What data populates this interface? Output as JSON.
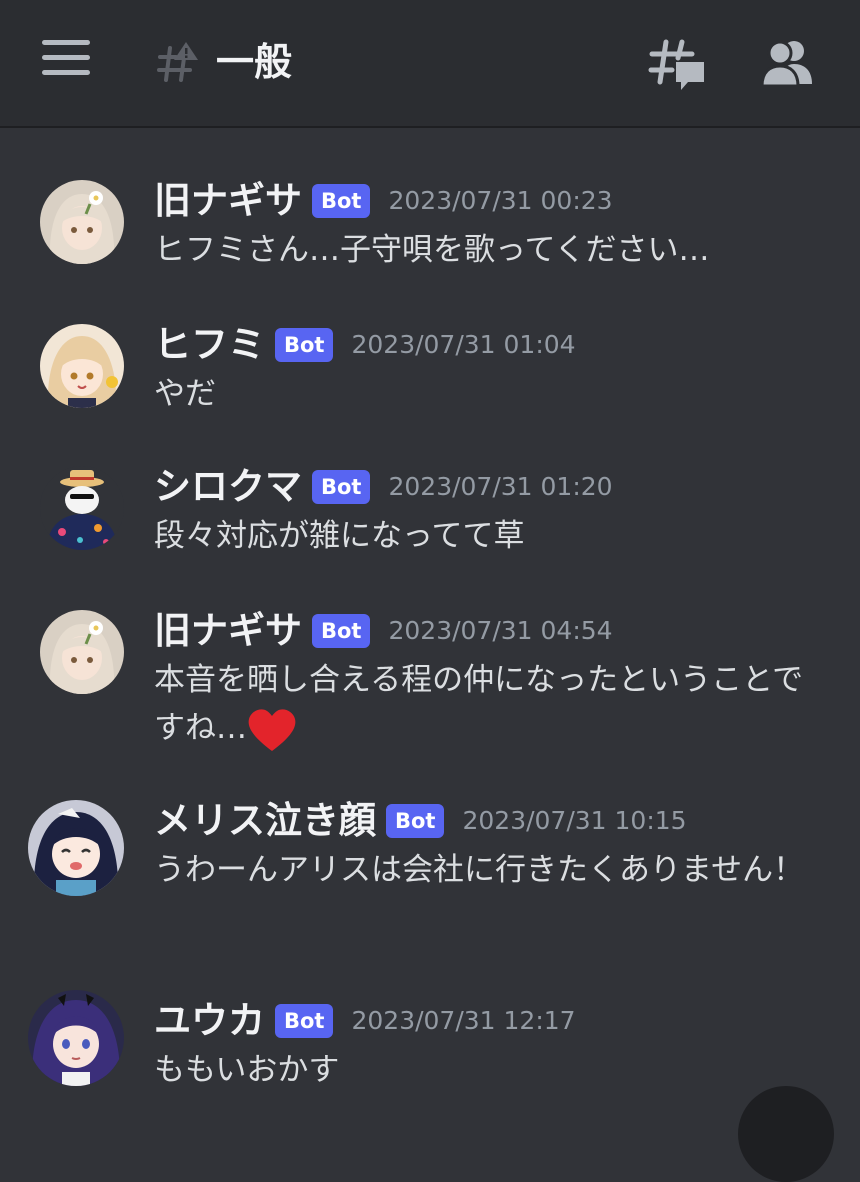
{
  "header": {
    "channel_name": "一般",
    "icons": {
      "menu": "hamburger-menu-icon",
      "channel": "locked-channel-hash-icon",
      "threads": "threads-icon",
      "members": "members-icon"
    }
  },
  "colors": {
    "background": "#313338",
    "header_background": "#2b2d31",
    "bot_badge": "#5865f2",
    "timestamp": "#949ba4",
    "heart": "#e3242b"
  },
  "messages": [
    {
      "author": "旧ナギサ",
      "badge": "Bot",
      "timestamp": "2023/07/31 00:23",
      "text": "ヒフミさん…子守唄を歌ってください…"
    },
    {
      "author": "ヒフミ",
      "badge": "Bot",
      "timestamp": "2023/07/31 01:04",
      "text": "やだ"
    },
    {
      "author": "シロクマ",
      "badge": "Bot",
      "timestamp": "2023/07/31 01:20",
      "text": "段々対応が雑になってて草"
    },
    {
      "author": "旧ナギサ",
      "badge": "Bot",
      "timestamp": "2023/07/31 04:54",
      "text": "本音を晒し合える程の仲になったということですね…",
      "emoji": "red-heart"
    },
    {
      "author": "メリス泣き顔",
      "badge": "Bot",
      "timestamp": "2023/07/31 10:15",
      "text": "うわーんアリスは会社に行きたくありません！"
    },
    {
      "author": "ユウカ",
      "badge": "Bot",
      "timestamp": "2023/07/31 12:17",
      "text": "ももいおかす"
    }
  ]
}
